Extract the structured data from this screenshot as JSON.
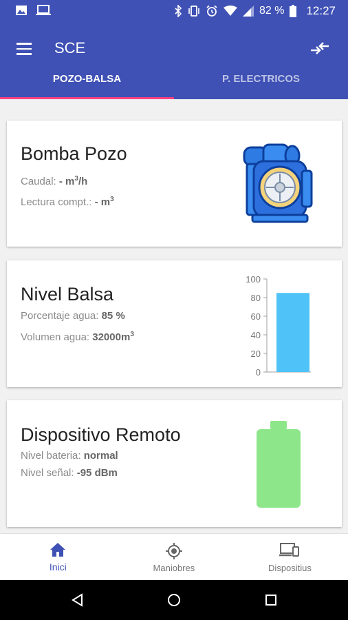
{
  "status_bar": {
    "battery_text": "82 %",
    "time": "12:27"
  },
  "app_bar": {
    "title": "SCE"
  },
  "tabs": [
    {
      "label": "POZO-BALSA",
      "active": true
    },
    {
      "label": "P. ELECTRICOS",
      "active": false
    }
  ],
  "cards": {
    "bomba": {
      "title": "Bomba Pozo",
      "caudal_label": "Caudal:",
      "caudal_value": "- m",
      "caudal_unit_sup": "3",
      "caudal_unit_rest": "/h",
      "lectura_label": "Lectura compt.:",
      "lectura_value": "- m",
      "lectura_unit_sup": "3"
    },
    "nivel": {
      "title": "Nivel Balsa",
      "porcentaje_label": "Porcentaje agua:",
      "porcentaje_value": "85 %",
      "volumen_label": "Volumen agua:",
      "volumen_value": "32000m",
      "volumen_unit_sup": "3"
    },
    "dispositivo": {
      "title": "Dispositivo Remoto",
      "bateria_label": "Nivel bateria:",
      "bateria_value": "normal",
      "senal_label": "Nivel señal:",
      "senal_value": "-95 dBm"
    }
  },
  "chart_data": {
    "type": "bar",
    "categories": [
      ""
    ],
    "values": [
      85
    ],
    "ylim": [
      0,
      100
    ],
    "yticks": [
      "0",
      "20",
      "40",
      "60",
      "80",
      "100"
    ],
    "bar_color": "#4fc3f7"
  },
  "bottom_nav": [
    {
      "label": "Inici",
      "icon": "home-icon",
      "active": true
    },
    {
      "label": "Maniobres",
      "icon": "gps-icon",
      "active": false
    },
    {
      "label": "Dispositius",
      "icon": "devices-icon",
      "active": false
    }
  ],
  "colors": {
    "primary": "#3f51b5",
    "accent": "#ff4081",
    "battery": "#8ee68a"
  }
}
